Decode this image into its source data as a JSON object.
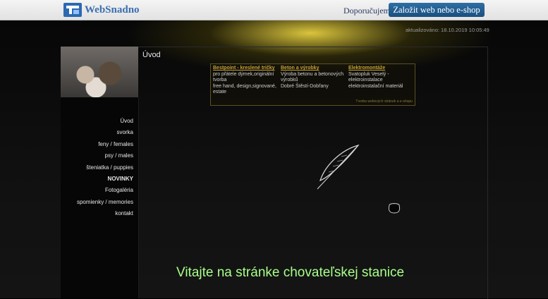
{
  "topbar": {
    "brand": "WebSnadno",
    "brand_icon": "websnadno-logo-icon",
    "recommend_label": "Doporučujeme",
    "cta_label": "Založit web nebo e-shop"
  },
  "updated_label": "aktualizováno: 18.10.2019 10:05:49",
  "page_title": "Úvod",
  "nav": [
    {
      "label": "Úvod",
      "bold": false
    },
    {
      "label": "svorka",
      "bold": false
    },
    {
      "label": "feny / females",
      "bold": false
    },
    {
      "label": "psy / males",
      "bold": false
    },
    {
      "label": "šteniatka / puppies",
      "bold": false
    },
    {
      "label": "NOVINKY",
      "bold": true
    },
    {
      "label": "Fotogaléria",
      "bold": false
    },
    {
      "label": "spomienky / memories",
      "bold": false
    },
    {
      "label": "kontakt",
      "bold": false
    }
  ],
  "ads": [
    {
      "head": "Bestpoint - kreslené tričky",
      "lines": [
        "pro přátele dýmek,originální tvorba",
        "free hand, design,signované, estate"
      ]
    },
    {
      "head": "Beton a výrobky",
      "lines": [
        "Výroba betonu a betonových výrobků",
        "Dobré Štěstí-Dobřany"
      ]
    },
    {
      "head": "Elektromontáže",
      "lines": [
        "Svatopluk Veselý - elektroinstalace",
        "elektroinstalační materiál"
      ]
    }
  ],
  "ads_footer": "Tvorba webových stránek a e-shopu",
  "welcome_text": "Vitajte na stránke chovateľskej stanice",
  "decor": {
    "feather": "feather-quill-icon",
    "inkpot": "inkpot-icon"
  },
  "colors": {
    "cta": "#1f5a8c",
    "welcome": "#a8ff8a",
    "ad_head": "#c6a235"
  }
}
